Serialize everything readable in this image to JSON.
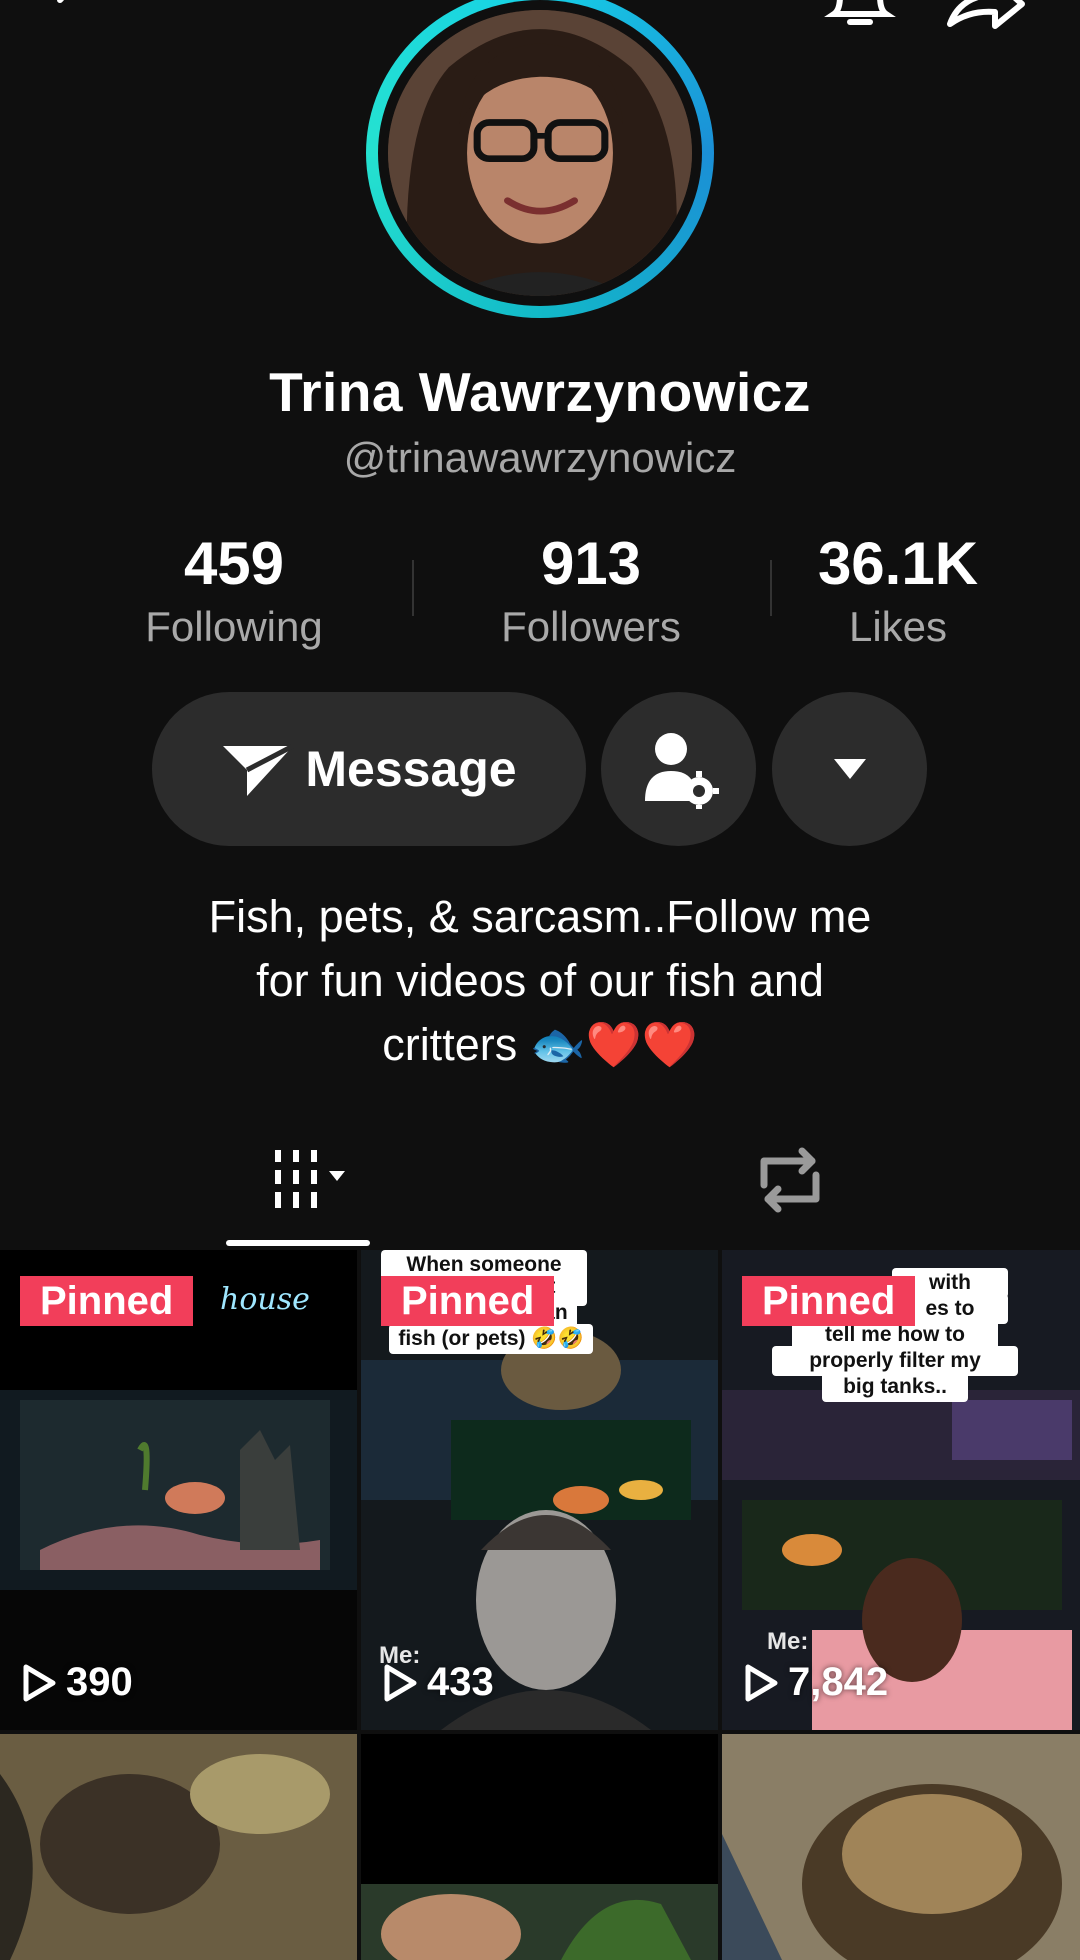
{
  "profile": {
    "name": "Trina Wawrzynowicz",
    "handle": "@trinawawrzynowicz",
    "bio_line1": "Fish, pets, & sarcasm..Follow me",
    "bio_line2": "for fun videos of our fish and",
    "bio_line3": "critters 🐟❤️❤️"
  },
  "stats": {
    "following": {
      "value": "459",
      "label": "Following"
    },
    "followers": {
      "value": "913",
      "label": "Followers"
    },
    "likes": {
      "value": "36.1K",
      "label": "Likes"
    }
  },
  "actions": {
    "message_label": "Message"
  },
  "icons": {
    "back": "chevron-left-icon",
    "bell": "bell-icon",
    "share": "share-icon",
    "message": "send-icon",
    "profile_settings": "user-gear-icon",
    "dropdown": "caret-down-icon",
    "videos_tab": "grid-bars-icon",
    "reposts_tab": "repost-icon",
    "play": "play-icon"
  },
  "colors": {
    "pinned": "#f23e5a",
    "ring": "#16d1e6",
    "background": "#0f0f0f"
  },
  "videos": [
    {
      "pinned": "Pinned",
      "views": "390",
      "overlay_text": "house"
    },
    {
      "pinned": "Pinned",
      "views": "433",
      "caption_top": "When someone tries",
      "caption_mid1": "out",
      "caption_mid2": "han",
      "caption_bottom": "fish (or pets) 🤣🤣",
      "me_label": "Me:"
    },
    {
      "pinned": "Pinned",
      "views": "7,842",
      "caption_top": "with",
      "caption_mid": "es to",
      "caption_line3": "tell me how to",
      "caption_line4": "properly filter my",
      "caption_line5": "big tanks..",
      "me_label": "Me:"
    }
  ]
}
